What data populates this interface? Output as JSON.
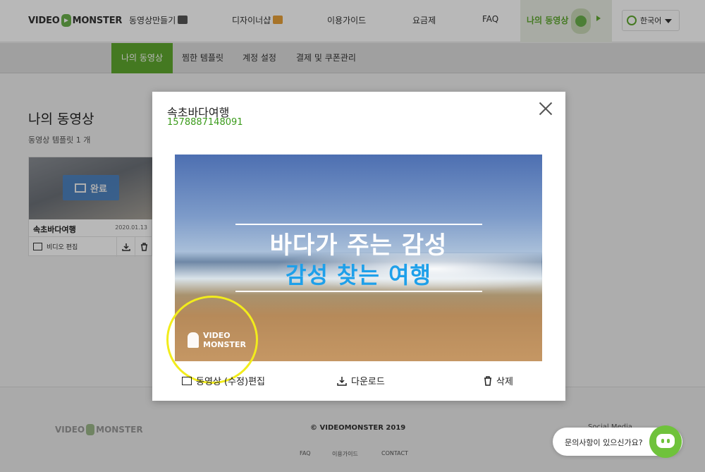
{
  "header": {
    "logo_left": "VIDEO",
    "logo_right": "MONSTER",
    "nav": [
      {
        "label": "동영상만들기"
      },
      {
        "label": "디자이너샵"
      },
      {
        "label": "이용가이드"
      },
      {
        "label": "요금제"
      },
      {
        "label": "FAQ"
      }
    ],
    "my_videos": "나의 동영상",
    "language": "한국어"
  },
  "subnav": {
    "tabs": [
      {
        "label": "나의 동영상",
        "active": true
      },
      {
        "label": "찜한 템플릿"
      },
      {
        "label": "계정 설정"
      },
      {
        "label": "결제 및 쿠폰관리"
      }
    ]
  },
  "main": {
    "title": "나의 동영상",
    "subtitle": "동영상 템플릿 1 개",
    "card": {
      "status": "완료",
      "name": "속초바다여행",
      "date": "2020.01.13",
      "edit_label": "비디오 편집"
    }
  },
  "footer": {
    "logo_left": "VIDEO",
    "logo_right": "MONSTER",
    "copyright": "© VIDEOMONSTER 2019",
    "links": [
      "FAQ",
      "이용가이드",
      "CONTACT"
    ],
    "social": "Social Media"
  },
  "modal": {
    "title": "속초바다여행",
    "id": "1578887148091",
    "video": {
      "caption_line1": "바다가 주는 감성",
      "caption_line2": "감성 찾는 여행",
      "watermark_line1": "VIDEO",
      "watermark_line2": "MONSTER"
    },
    "actions": {
      "edit": "동영상 (수정)편집",
      "download": "다운로드",
      "delete": "삭제"
    }
  },
  "chat": {
    "prompt": "문의사항이 있으신가요?"
  },
  "colors": {
    "brand_green": "#5fa82f",
    "id_green": "#3a9a1a",
    "caption_blue": "#1ea0ea",
    "highlight_yellow": "#f2ec1c"
  }
}
